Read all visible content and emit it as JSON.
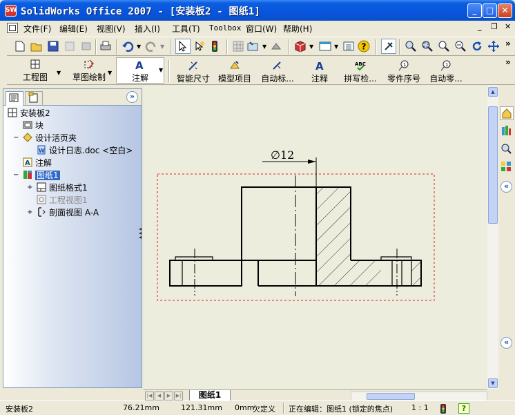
{
  "window": {
    "logo_text": "SW",
    "title": "SolidWorks Office 2007 - [安装板2 - 图纸1]",
    "minimize": "_",
    "maximize": "□",
    "close": "✕"
  },
  "menu": {
    "items": [
      "文件(F)",
      "编辑(E)",
      "视图(V)",
      "插入(I)",
      "工具(T)",
      "Toolbox",
      "窗口(W)",
      "帮助(H)"
    ],
    "doc_min": "_",
    "doc_restore": "❐",
    "doc_close": "✕"
  },
  "toolbar_icons": [
    "new-icon",
    "open-icon",
    "save-icon",
    "print-icon",
    "undo-icon",
    "redo-icon",
    "select-icon",
    "smart-select-icon",
    "traffic-light-icon",
    "grid-icon",
    "snap-icon",
    "feature-icon",
    "box-icon",
    "view-icon",
    "list-icon",
    "help-icon",
    "pin-icon",
    "zoom-fit-icon",
    "zoom-area-icon",
    "zoom-icon",
    "zoom-in-out-icon",
    "rotate-icon",
    "pan-icon"
  ],
  "command_manager": {
    "tabs": [
      {
        "label": "工程图",
        "icon": "drawing-icon"
      },
      {
        "label": "草图绘制",
        "icon": "sketch-icon"
      },
      {
        "label": "注解",
        "icon": "annotation-icon"
      }
    ],
    "buttons": [
      {
        "label": "智能尺寸",
        "icon": "smart-dimension-icon"
      },
      {
        "label": "模型项目",
        "icon": "model-items-icon"
      },
      {
        "label": "自动标...",
        "icon": "auto-dimension-icon"
      },
      {
        "label": "注释",
        "icon": "note-icon"
      },
      {
        "label": "拼写检...",
        "icon": "spell-check-icon"
      },
      {
        "label": "零件序号",
        "icon": "balloon-icon"
      },
      {
        "label": "自动零...",
        "icon": "auto-balloon-icon"
      }
    ],
    "more": "»"
  },
  "feature_tree": {
    "collapse": "»",
    "items": [
      {
        "label": "安装板2",
        "level": 0,
        "expander": "",
        "icon": "drawing-doc-icon",
        "selected": false,
        "dimmed": false
      },
      {
        "label": "块",
        "level": 1,
        "expander": "",
        "icon": "block-icon",
        "selected": false,
        "dimmed": false
      },
      {
        "label": "设计活页夹",
        "level": 1,
        "expander": "−",
        "icon": "binder-icon",
        "selected": false,
        "dimmed": false
      },
      {
        "label": "设计日志.doc <空白>",
        "level": 2,
        "expander": "",
        "icon": "doc-icon",
        "selected": false,
        "dimmed": false
      },
      {
        "label": "注解",
        "level": 1,
        "expander": "",
        "icon": "annotation-folder-icon",
        "selected": false,
        "dimmed": false
      },
      {
        "label": "图纸1",
        "level": 1,
        "expander": "−",
        "icon": "sheet-icon",
        "selected": true,
        "dimmed": false
      },
      {
        "label": "图纸格式1",
        "level": 2,
        "expander": "+",
        "icon": "sheet-format-icon",
        "selected": false,
        "dimmed": false
      },
      {
        "label": "工程视图1",
        "level": 2,
        "expander": "",
        "icon": "drawing-view-icon",
        "selected": false,
        "dimmed": true
      },
      {
        "label": "剖面视图 A-A",
        "level": 2,
        "expander": "+",
        "icon": "section-view-icon",
        "selected": false,
        "dimmed": false
      }
    ]
  },
  "drawing": {
    "dimension_text": "∅12"
  },
  "sheet_tabs": {
    "active": "图纸1"
  },
  "status": {
    "doc": "安装板2",
    "x": "76.21mm",
    "y": "121.31mm",
    "z": "0mm",
    "state": "欠定义",
    "editing": "正在编辑：图纸1 (锁定的焦点)",
    "scale": "1 : 1",
    "help": "?"
  }
}
